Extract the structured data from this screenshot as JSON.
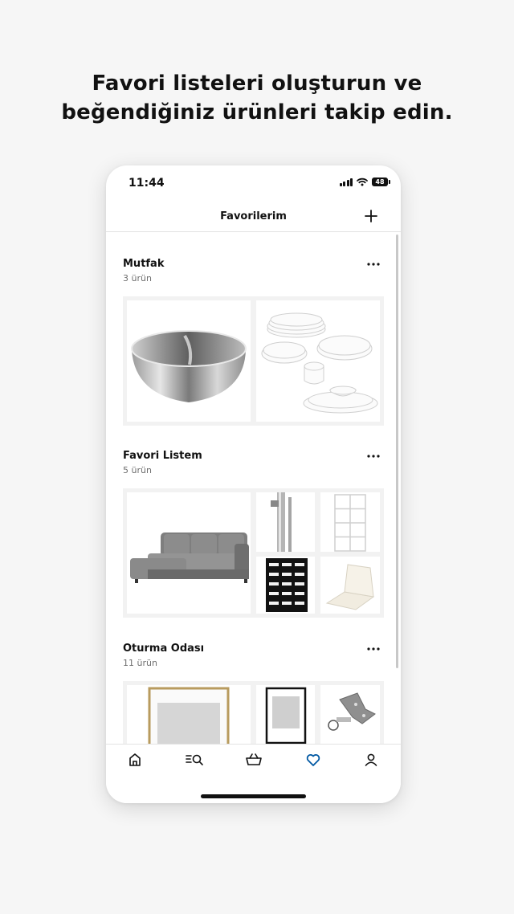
{
  "headline": {
    "line1": "Favori listeleri oluşturun ve",
    "line2": "beğendiğiniz ürünleri takip edin."
  },
  "status_bar": {
    "time": "11:44",
    "battery": "48"
  },
  "header": {
    "title": "Favorilerim",
    "add_icon": "plus-icon"
  },
  "lists": [
    {
      "name": "Mutfak",
      "count": "3 ürün"
    },
    {
      "name": "Favori Listem",
      "count": "5 ürün"
    },
    {
      "name": "Oturma Odası",
      "count": "11 ürün"
    }
  ],
  "tabs": [
    {
      "icon": "home-icon",
      "active": false
    },
    {
      "icon": "search-list-icon",
      "active": false
    },
    {
      "icon": "basket-icon",
      "active": false
    },
    {
      "icon": "heart-icon",
      "active": true
    },
    {
      "icon": "profile-icon",
      "active": false
    }
  ],
  "colors": {
    "active_tab": "#0058a3",
    "text": "#111111",
    "muted": "#6f6f6f"
  }
}
